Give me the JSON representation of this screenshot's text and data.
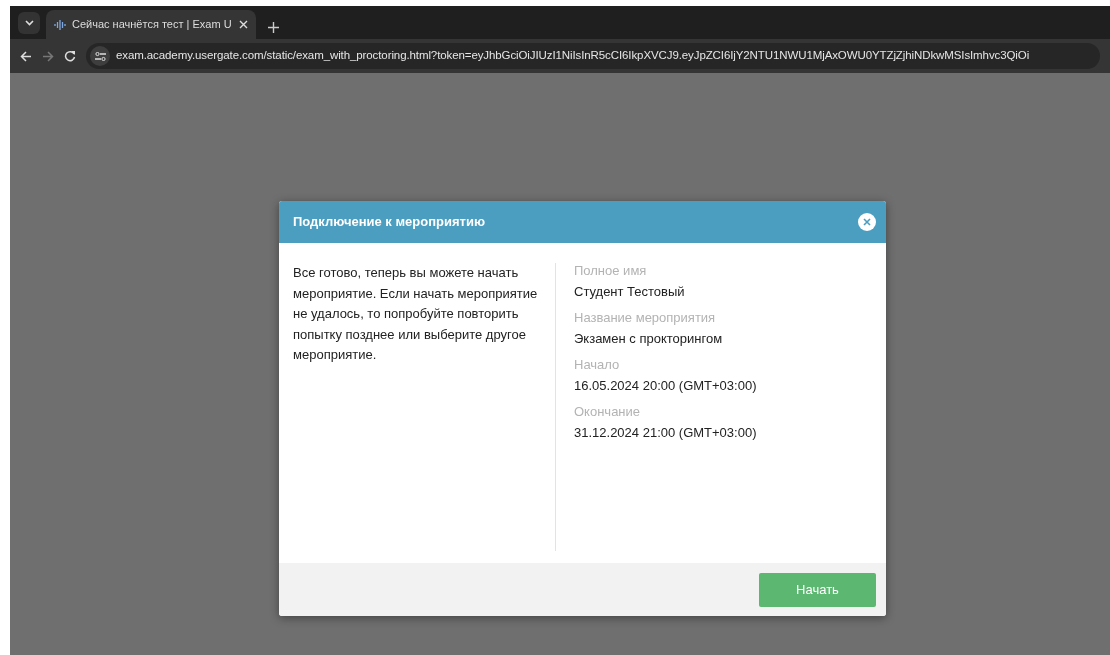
{
  "browser": {
    "tab_title": "Сейчас начнётся тест | Exam U",
    "url": "exam.academy.usergate.com/static/exam_with_proctoring.html?token=eyJhbGciOiJIUzI1NiIsInR5cCI6IkpXVCJ9.eyJpZCI6IjY2NTU1NWU1MjAxOWU0YTZjZjhiNDkwMSIsImhvc3QiOi"
  },
  "dialog": {
    "title": "Подключение к мероприятию",
    "message": "Все готово, теперь вы можете начать мероприятие. Если начать мероприятие не удалось, то попробуйте повторить попытку позднее или выберите другое мероприятие.",
    "fields": [
      {
        "label": "Полное имя",
        "value": "Студент Тестовый"
      },
      {
        "label": "Название мероприятия",
        "value": "Экзамен с прокторингом"
      },
      {
        "label": "Начало",
        "value": "16.05.2024 20:00 (GMT+03:00)"
      },
      {
        "label": "Окончание",
        "value": "31.12.2024 21:00 (GMT+03:00)"
      }
    ],
    "button": "Начать"
  }
}
